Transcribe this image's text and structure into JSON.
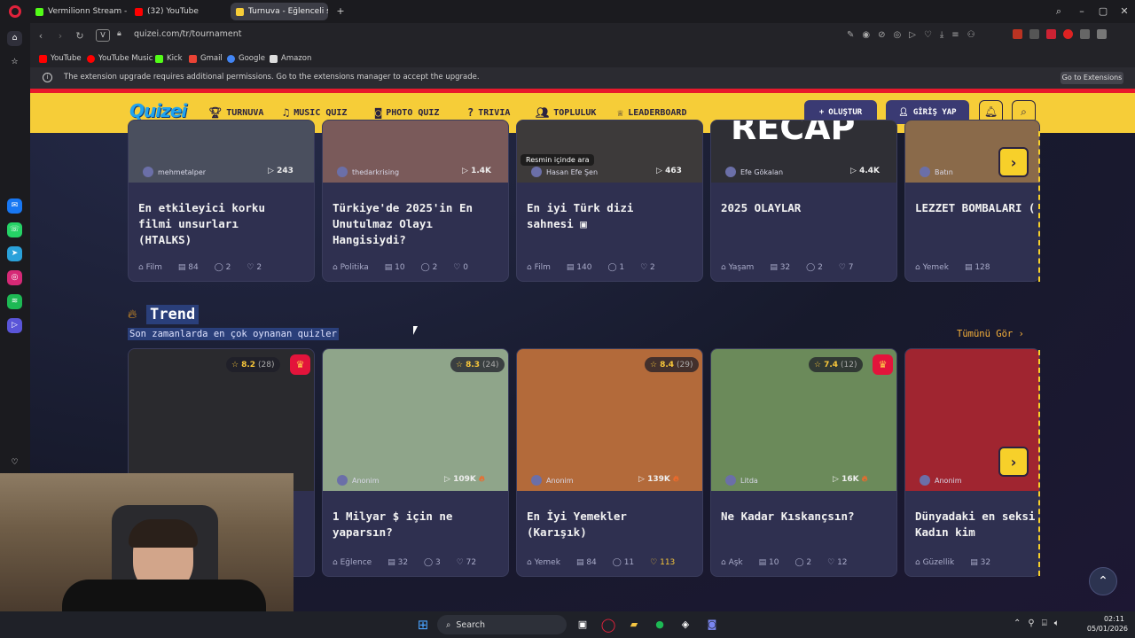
{
  "browser": {
    "tabs": [
      {
        "label": "Vermilionn Stream - Watc",
        "icon_color": "#53fc18"
      },
      {
        "label": "(32) YouTube",
        "icon_color": "#ff0000"
      },
      {
        "label": "Turnuva - Eğlenceli seçim",
        "icon_color": "#f6cd38"
      }
    ],
    "url": "quizei.com/tr/tournament",
    "url_prefix": "V",
    "bookmarks": [
      "YouTube",
      "YouTube Music",
      "Kick",
      "Gmail",
      "Google",
      "Amazon"
    ],
    "extension_notice": "The extension upgrade requires additional permissions. Go to the extensions manager to accept the upgrade.",
    "extension_button": "Go to Extensions"
  },
  "site": {
    "logo": "Quizei",
    "nav": [
      "TURNUVA",
      "MUSIC QUIZ",
      "PHOTO QUIZ",
      "TRIVIA",
      "TOPLULUK",
      "LEADERBOARD"
    ],
    "create_label": "OLUŞTUR",
    "login_label": "GİRİŞ YAP"
  },
  "top_cards": [
    {
      "author": "mehmetalper",
      "plays": "243",
      "title_lines": [
        "En etkileyici korku",
        "filmi unsurları",
        "(HTALKS)"
      ],
      "category": "Film",
      "questions": "84",
      "comments": "2",
      "likes": "2",
      "img_color": "#4a4f5e"
    },
    {
      "author": "thedarkrising",
      "plays": "1.4K",
      "title_lines": [
        "Türkiye'de 2025'in En",
        "Unutulmaz Olayı",
        "Hangisiydi?"
      ],
      "category": "Politika",
      "questions": "10",
      "comments": "2",
      "likes": "0",
      "img_color": "#7a5a5a"
    },
    {
      "author": "Hasan Efe Şen",
      "plays": "463",
      "title_lines": [
        "En iyi Türk dizi",
        "sahnesi ▣"
      ],
      "category": "Film",
      "questions": "140",
      "comments": "1",
      "likes": "2",
      "img_color": "#3d3a3a",
      "overlay": "Resmin içinde ara"
    },
    {
      "author": "Efe Gökalan",
      "plays": "4.4K",
      "title_lines": [
        "2025 OLAYLAR"
      ],
      "category": "Yaşam",
      "questions": "32",
      "comments": "2",
      "likes": "7",
      "img_color": "#2f2f35",
      "overlay": "RECAP"
    },
    {
      "author": "Batın",
      "plays": "",
      "title_lines": [
        "LEZZET BOMBALARI ("
      ],
      "category": "Yemek",
      "questions": "128",
      "comments": "",
      "likes": "",
      "img_color": "#8a6a4a"
    }
  ],
  "trend": {
    "title": "Trend",
    "subtitle": "Son zamanlarda en çok oynanan quizler",
    "see_all": "Tümünü Gör"
  },
  "trend_cards": [
    {
      "rating": "8.2",
      "votes": "(28)",
      "crown": true,
      "author": "",
      "plays": "",
      "title_lines": [],
      "category": "",
      "questions": "32",
      "comments": "",
      "likes": "",
      "img_color": "#2a2a2e"
    },
    {
      "rating": "8.3",
      "votes": "(24)",
      "crown": false,
      "author": "Anonim",
      "plays": "109K",
      "title_lines": [
        "1 Milyar $ için ne",
        "yaparsın?"
      ],
      "category": "Eğlence",
      "questions": "32",
      "comments": "3",
      "likes": "72",
      "img_color": "#8fa58a"
    },
    {
      "rating": "8.4",
      "votes": "(29)",
      "crown": false,
      "author": "Anonim",
      "plays": "139K",
      "title_lines": [
        "En İyi Yemekler",
        "(Karışık)"
      ],
      "category": "Yemek",
      "questions": "84",
      "comments": "11",
      "likes": "113",
      "liked": true,
      "img_color": "#b36a3a"
    },
    {
      "rating": "7.4",
      "votes": "(12)",
      "crown": true,
      "author": "Litda",
      "plays": "16K",
      "title_lines": [
        "Ne Kadar Kıskançsın?"
      ],
      "category": "Aşk",
      "questions": "10",
      "comments": "2",
      "likes": "12",
      "img_color": "#6b8a5a"
    },
    {
      "rating": "",
      "votes": "",
      "crown": false,
      "author": "Anonim",
      "plays": "",
      "title_lines": [
        "Dünyadaki en seksi",
        "Kadın kim"
      ],
      "category": "Güzellik",
      "questions": "32",
      "comments": "",
      "likes": "",
      "img_color": "#a02530"
    }
  ],
  "taskbar": {
    "search": "Search",
    "time": "02:11",
    "date": "05/01/2026"
  }
}
